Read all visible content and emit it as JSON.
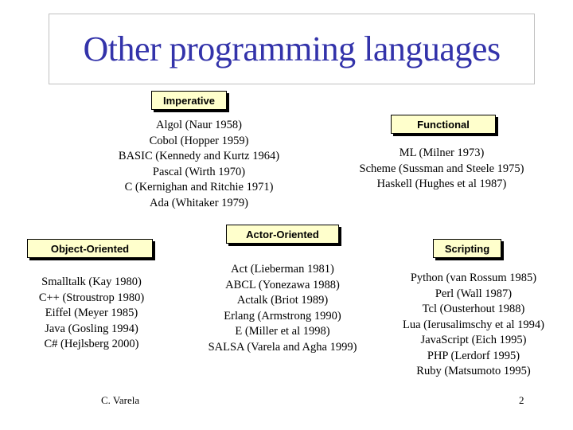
{
  "slide": {
    "title": "Other programming languages",
    "footer_author": "C. Varela",
    "page_number": "2",
    "colors": {
      "title": "#3333aa",
      "category_fill": "#ffffcc",
      "category_border": "#000000",
      "title_frame": "#c0c0c0"
    }
  },
  "categories": {
    "imperative": {
      "label": "Imperative",
      "items": [
        "Algol (Naur 1958)",
        "Cobol (Hopper 1959)",
        "BASIC (Kennedy and Kurtz 1964)",
        "Pascal (Wirth 1970)",
        "C (Kernighan and Ritchie 1971)",
        "Ada (Whitaker 1979)"
      ]
    },
    "functional": {
      "label": "Functional",
      "items": [
        "ML (Milner 1973)",
        "Scheme (Sussman and Steele 1975)",
        "Haskell (Hughes et al 1987)"
      ]
    },
    "object_oriented": {
      "label": "Object-Oriented",
      "items": [
        "Smalltalk (Kay 1980)",
        "C++ (Stroustrop 1980)",
        "Eiffel (Meyer 1985)",
        "Java (Gosling 1994)",
        "C# (Hejlsberg 2000)"
      ]
    },
    "actor_oriented": {
      "label": "Actor-Oriented",
      "items": [
        "Act (Lieberman 1981)",
        "ABCL (Yonezawa 1988)",
        "Actalk (Briot 1989)",
        "Erlang (Armstrong 1990)",
        "E (Miller et al 1998)",
        "SALSA (Varela and Agha 1999)"
      ]
    },
    "scripting": {
      "label": "Scripting",
      "items": [
        "Python (van Rossum 1985)",
        "Perl (Wall 1987)",
        "Tcl (Ousterhout 1988)",
        "Lua (Ierusalimschy et al 1994)",
        "JavaScript (Eich 1995)",
        "PHP (Lerdorf 1995)",
        "Ruby (Matsumoto 1995)"
      ]
    }
  }
}
